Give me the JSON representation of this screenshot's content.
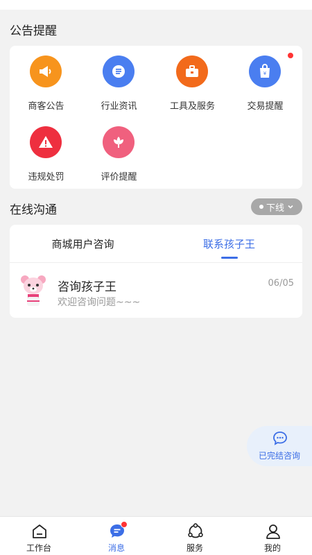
{
  "notice": {
    "title": "公告提醒",
    "items": [
      {
        "label": "商客公告",
        "icon": "megaphone-icon",
        "color": "#f7941d",
        "badge": false
      },
      {
        "label": "行业资讯",
        "icon": "news-icon",
        "color": "#4a7ef0",
        "badge": false
      },
      {
        "label": "工具及服务",
        "icon": "toolbox-icon",
        "color": "#f26a1b",
        "badge": false
      },
      {
        "label": "交易提醒",
        "icon": "shopping-bag-icon",
        "color": "#4a7ef0",
        "badge": true
      },
      {
        "label": "违规处罚",
        "icon": "warning-icon",
        "color": "#ee2f3f",
        "badge": false
      },
      {
        "label": "评价提醒",
        "icon": "flower-icon",
        "color": "#f0607e",
        "badge": false
      }
    ]
  },
  "chat": {
    "title": "在线沟通",
    "status_label": "下线",
    "tabs": [
      {
        "label": "商城用户咨询",
        "active": false
      },
      {
        "label": "联系孩子王",
        "active": true
      }
    ],
    "conversation": {
      "name": "咨询孩子王",
      "message": "欢迎咨询问题~~~",
      "date": "06/05"
    }
  },
  "float_button": {
    "label": "已完结咨询"
  },
  "bottom_nav": {
    "items": [
      {
        "label": "工作台",
        "icon": "workbench-icon",
        "active": false,
        "badge": false
      },
      {
        "label": "消息",
        "icon": "message-icon",
        "active": true,
        "badge": true
      },
      {
        "label": "服务",
        "icon": "service-icon",
        "active": false,
        "badge": false
      },
      {
        "label": "我的",
        "icon": "profile-icon",
        "active": false,
        "badge": false
      }
    ]
  },
  "colors": {
    "accent": "#3c6ee6",
    "badge": "#ff3333"
  }
}
